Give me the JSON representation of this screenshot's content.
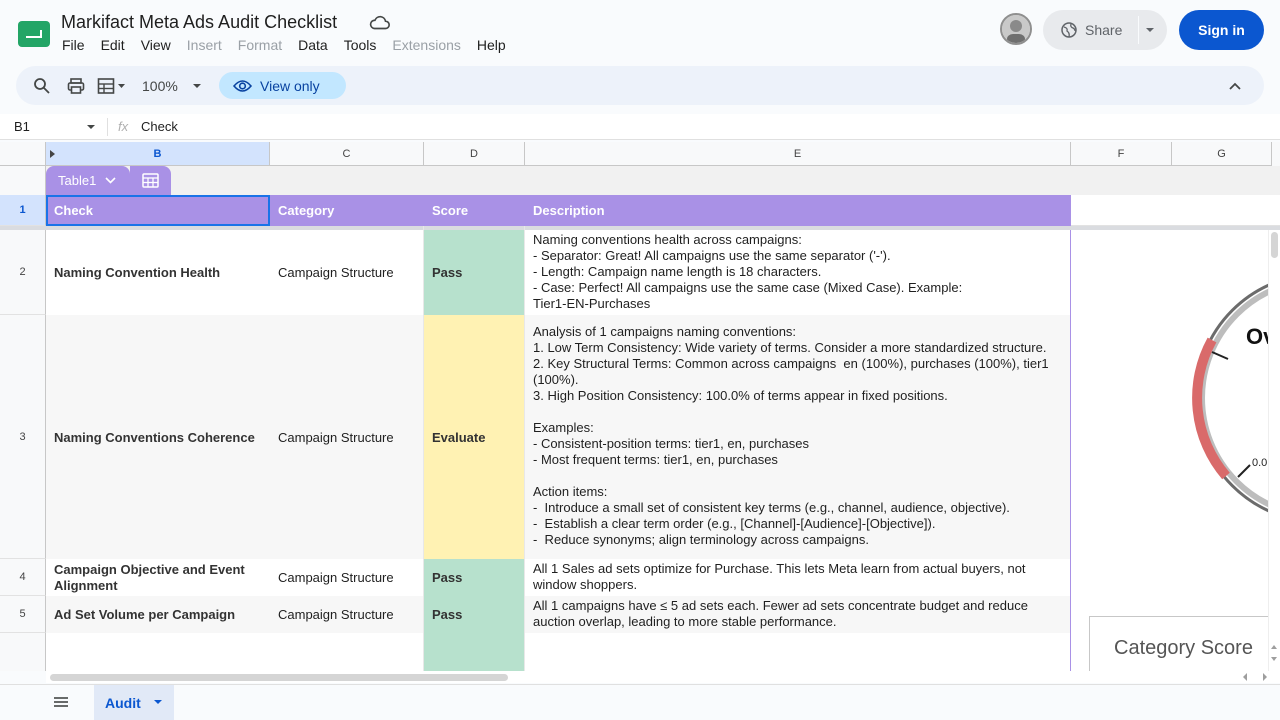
{
  "doc": {
    "title": "Markifact Meta Ads Audit Checklist"
  },
  "menu": [
    "File",
    "Edit",
    "View",
    "Insert",
    "Format",
    "Data",
    "Tools",
    "Extensions",
    "Help"
  ],
  "menu_disabled": [
    "Insert",
    "Format",
    "Extensions"
  ],
  "header_actions": {
    "share": "Share",
    "sign_in": "Sign in"
  },
  "toolbar": {
    "zoom": "100%",
    "view_only": "View only"
  },
  "formula_bar": {
    "cell_ref": "B1",
    "fx": "fx",
    "value": "Check"
  },
  "columns": [
    "B",
    "C",
    "D",
    "E",
    "F",
    "G"
  ],
  "table": {
    "name": "Table1",
    "headers": [
      "Check",
      "Category",
      "Score",
      "Description"
    ],
    "rows": [
      {
        "num": "2",
        "check": "Naming Convention Health",
        "category": "Campaign Structure",
        "score": "Pass",
        "description": "Naming conventions health across campaigns:\n- Separator: Great! All campaigns use the same separator ('-').\n- Length: Campaign name length is 18 characters.\n- Case: Perfect! All campaigns use the same case (Mixed Case). Example:\nTier1-EN-Purchases"
      },
      {
        "num": "3",
        "check": "Naming Conventions Coherence",
        "category": "Campaign Structure",
        "score": "Evaluate",
        "description": "Analysis of 1 campaigns naming conventions:\n1. Low Term Consistency: Wide variety of terms. Consider a more standardized structure.\n2. Key Structural Terms: Common across campaigns  en (100%), purchases (100%), tier1\n(100%).\n3. High Position Consistency: 100.0% of terms appear in fixed positions.\n\nExamples:\n- Consistent-position terms: tier1, en, purchases\n- Most frequent terms: tier1, en, purchases\n\nAction items:\n-  Introduce a small set of consistent key terms (e.g., channel, audience, objective).\n-  Establish a clear term order (e.g., [Channel]-[Audience]-[Objective]).\n-  Reduce synonyms; align terminology across campaigns."
      },
      {
        "num": "4",
        "check": "Campaign Objective and Event\nAlignment",
        "category": "Campaign Structure",
        "score": "Pass",
        "description": "All 1 Sales ad sets optimize for Purchase. This lets Meta learn from actual buyers, not\nwindow shoppers."
      },
      {
        "num": "5",
        "check": "Ad Set Volume per Campaign",
        "category": "Campaign Structure",
        "score": "Pass",
        "description": "All 1 campaigns have ≤ 5 ad sets each. Fewer ad sets concentrate budget and reduce\nauction overlap, leading to more stable performance."
      }
    ]
  },
  "gauge": {
    "label_partial": "Ov",
    "tick_label": "0.0"
  },
  "category_score_card": {
    "title": "Category Score"
  },
  "sheet_tab": {
    "name": "Audit"
  },
  "colors": {
    "pass": "#b7e1cd",
    "evaluate": "#fff2b3",
    "table_header": "#a991e6",
    "accent": "#0b57d0"
  },
  "icons": [
    "cloud-icon",
    "search-icon",
    "print-icon",
    "format-icon",
    "eye-icon",
    "collapse-icon",
    "globe-icon",
    "menu-icon",
    "table-settings-icon"
  ]
}
